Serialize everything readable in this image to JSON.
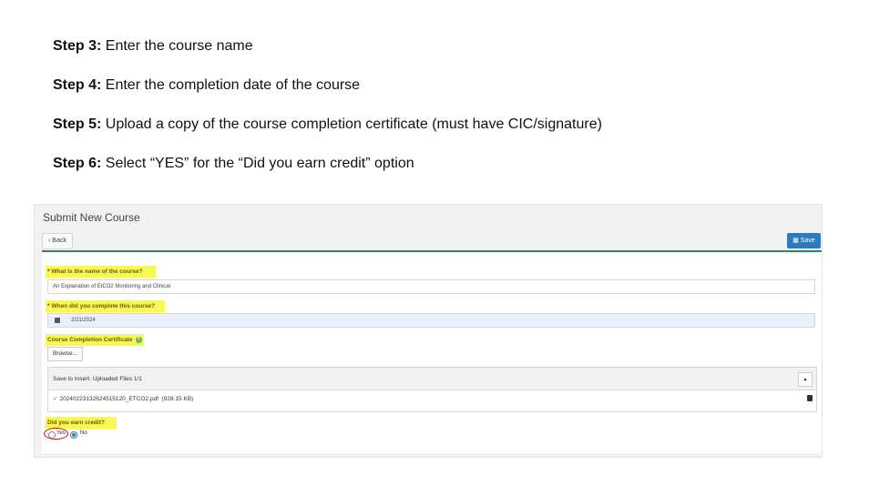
{
  "steps": [
    {
      "prefix": "Step 3:",
      "text": " Enter the course name"
    },
    {
      "prefix": "Step 4:",
      "text": " Enter the completion date of the course"
    },
    {
      "prefix": "Step 5:",
      "text": " Upload a copy of the course completion certificate (must have CIC/signature)"
    },
    {
      "prefix": "Step 6:",
      "text": " Select “YES” for the “Did you earn credit” option"
    }
  ],
  "screenshot": {
    "title": "Submit New Course",
    "back_label": "Back",
    "save_label": "Save",
    "course_name": {
      "label": "What is the name of the course?",
      "required": "*",
      "value": "An Explanation of EtCO2 Monitoring and Clinical"
    },
    "completion_date": {
      "label": "When did you complete this course?",
      "required": "*",
      "value": "2/21/2024"
    },
    "certificate": {
      "label": "Course Completion Certificate",
      "browse_label": "Browse...",
      "files_header": "Save to Insert. Uploaded Files 1/1",
      "file_name": "20240223132624515120_ETCO2.pdf",
      "file_size": "(928.15 KB)"
    },
    "credit": {
      "label": "Did you earn credit?",
      "yes_label": "Yes",
      "no_label": "No",
      "selected": "No"
    },
    "colors": {
      "highlight": "#f7f75a",
      "accent": "#2f7ab8",
      "divider": "#2e8b57",
      "circle": "#c8102e"
    }
  }
}
